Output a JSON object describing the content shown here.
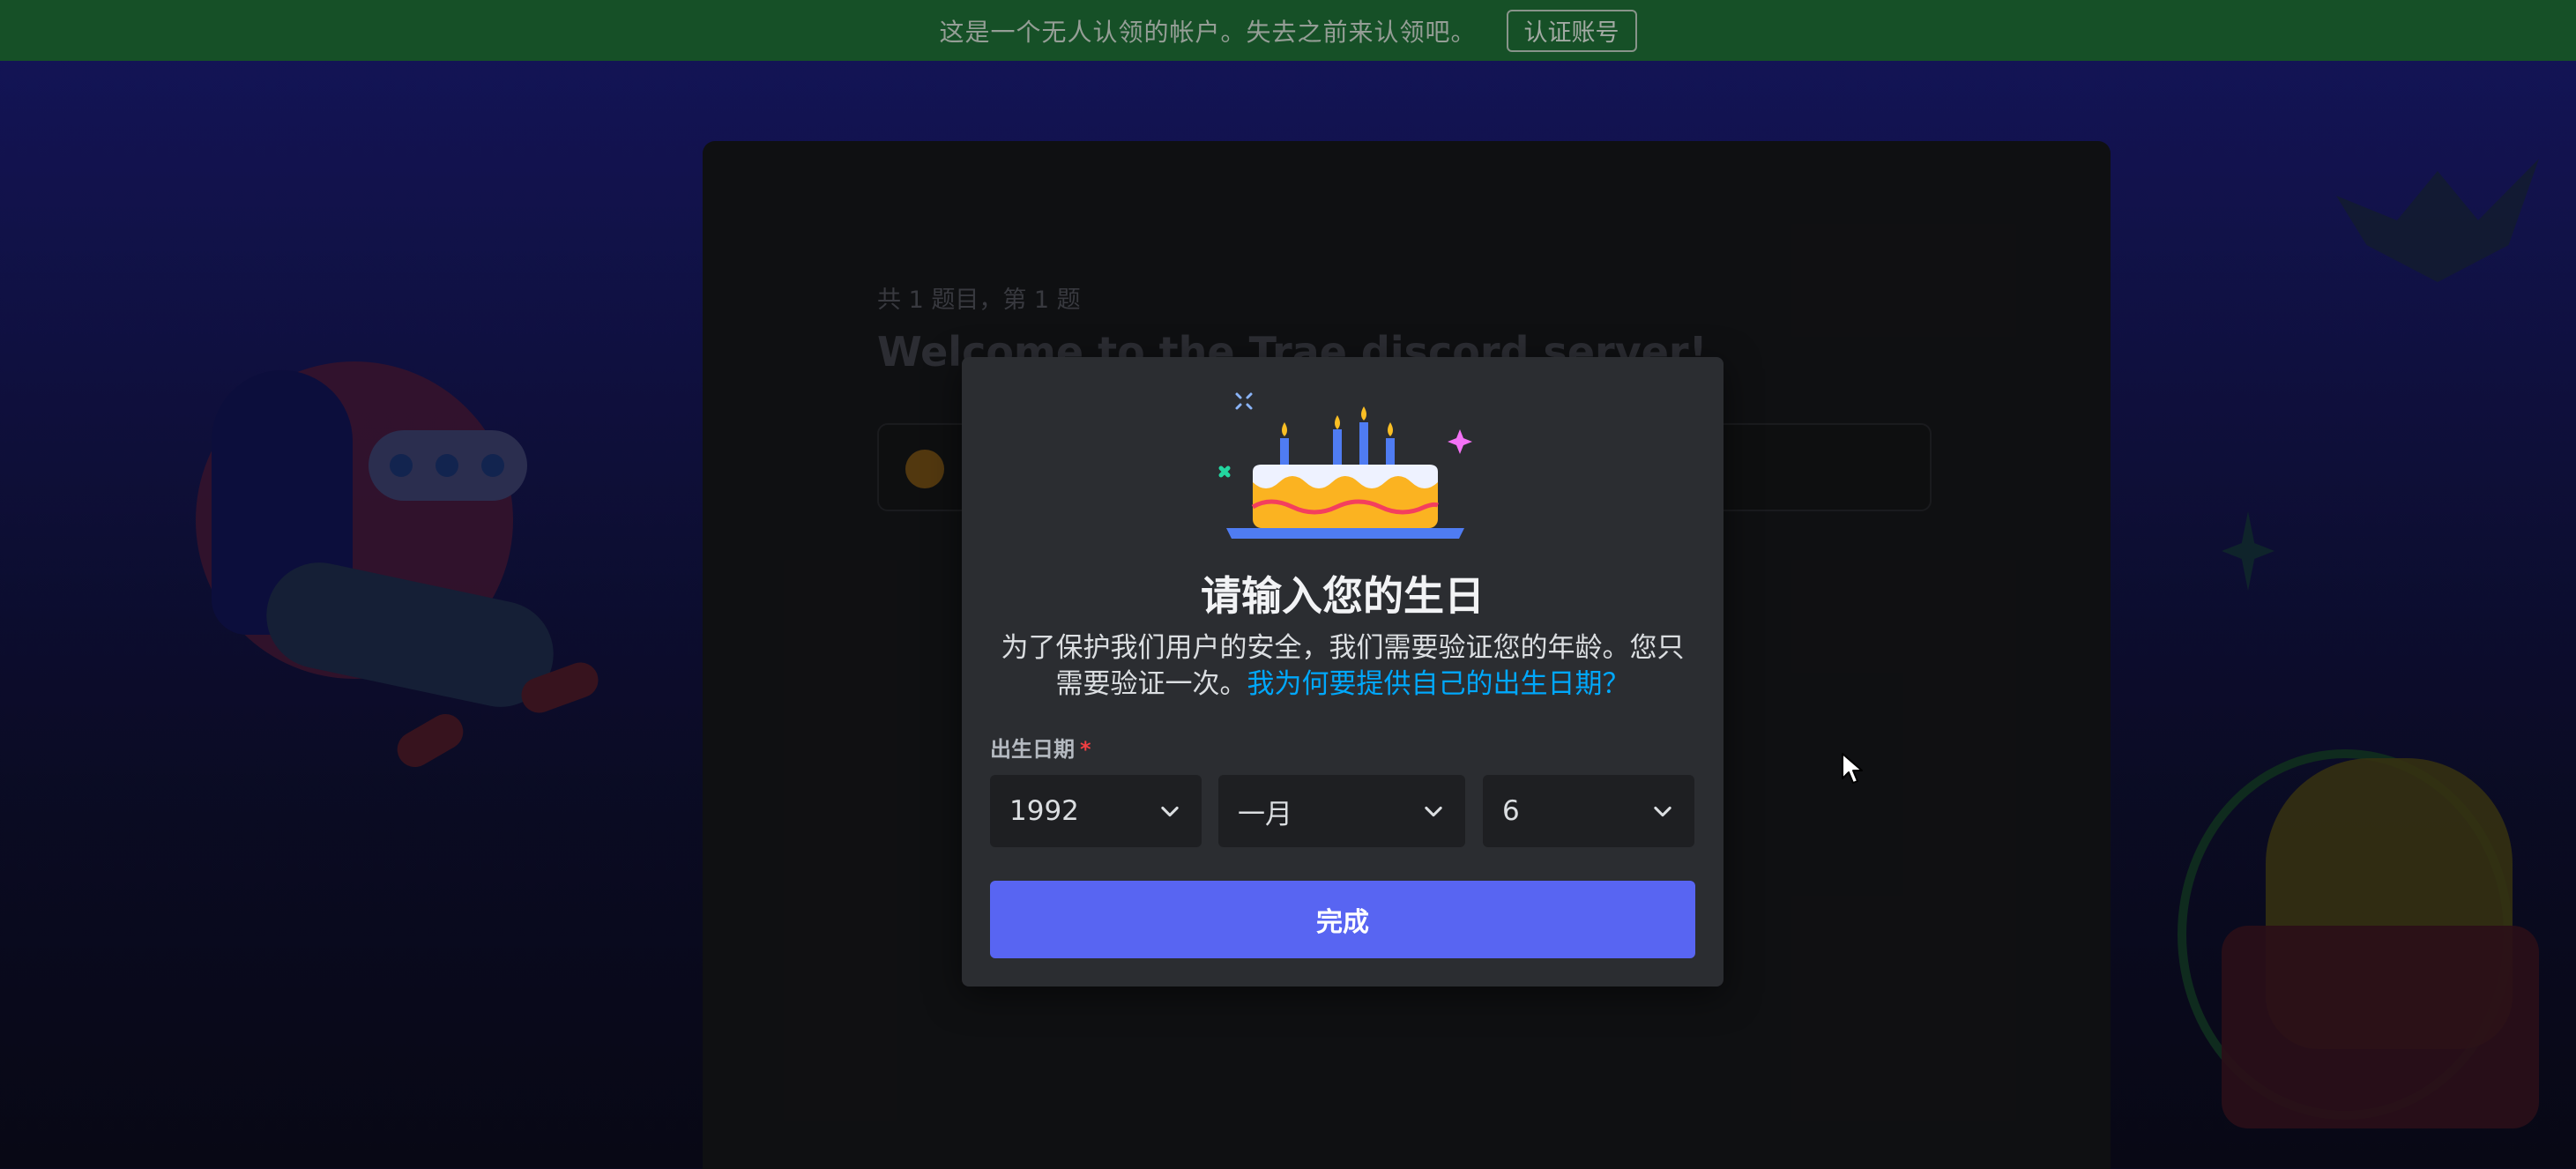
{
  "notice_bar": {
    "message": "这是一个无人认领的帐户。失去之前来认领吧。",
    "claim_button": "认证账号"
  },
  "background_card": {
    "question_count": "共 1 题目，第 1 题",
    "welcome_title": "Welcome to the Trae discord server!"
  },
  "modal": {
    "icon": "birthday-cake-icon",
    "title": "请输入您的生日",
    "description": "为了保护我们用户的安全，我们需要验证您的年龄。您只需要验证一次。",
    "why_link": "我为何要提供自己的出生日期？",
    "dob_label": "出生日期",
    "required_mark": "*",
    "year_value": "1992",
    "month_value": "一月",
    "day_value": "6",
    "done_button": "完成"
  },
  "colors": {
    "notice_bg": "#1e6b34",
    "modal_bg": "#2b2d31",
    "select_bg": "#1e1f22",
    "primary_button": "#5865f2",
    "link": "#00a8fc",
    "required": "#f23f42"
  }
}
